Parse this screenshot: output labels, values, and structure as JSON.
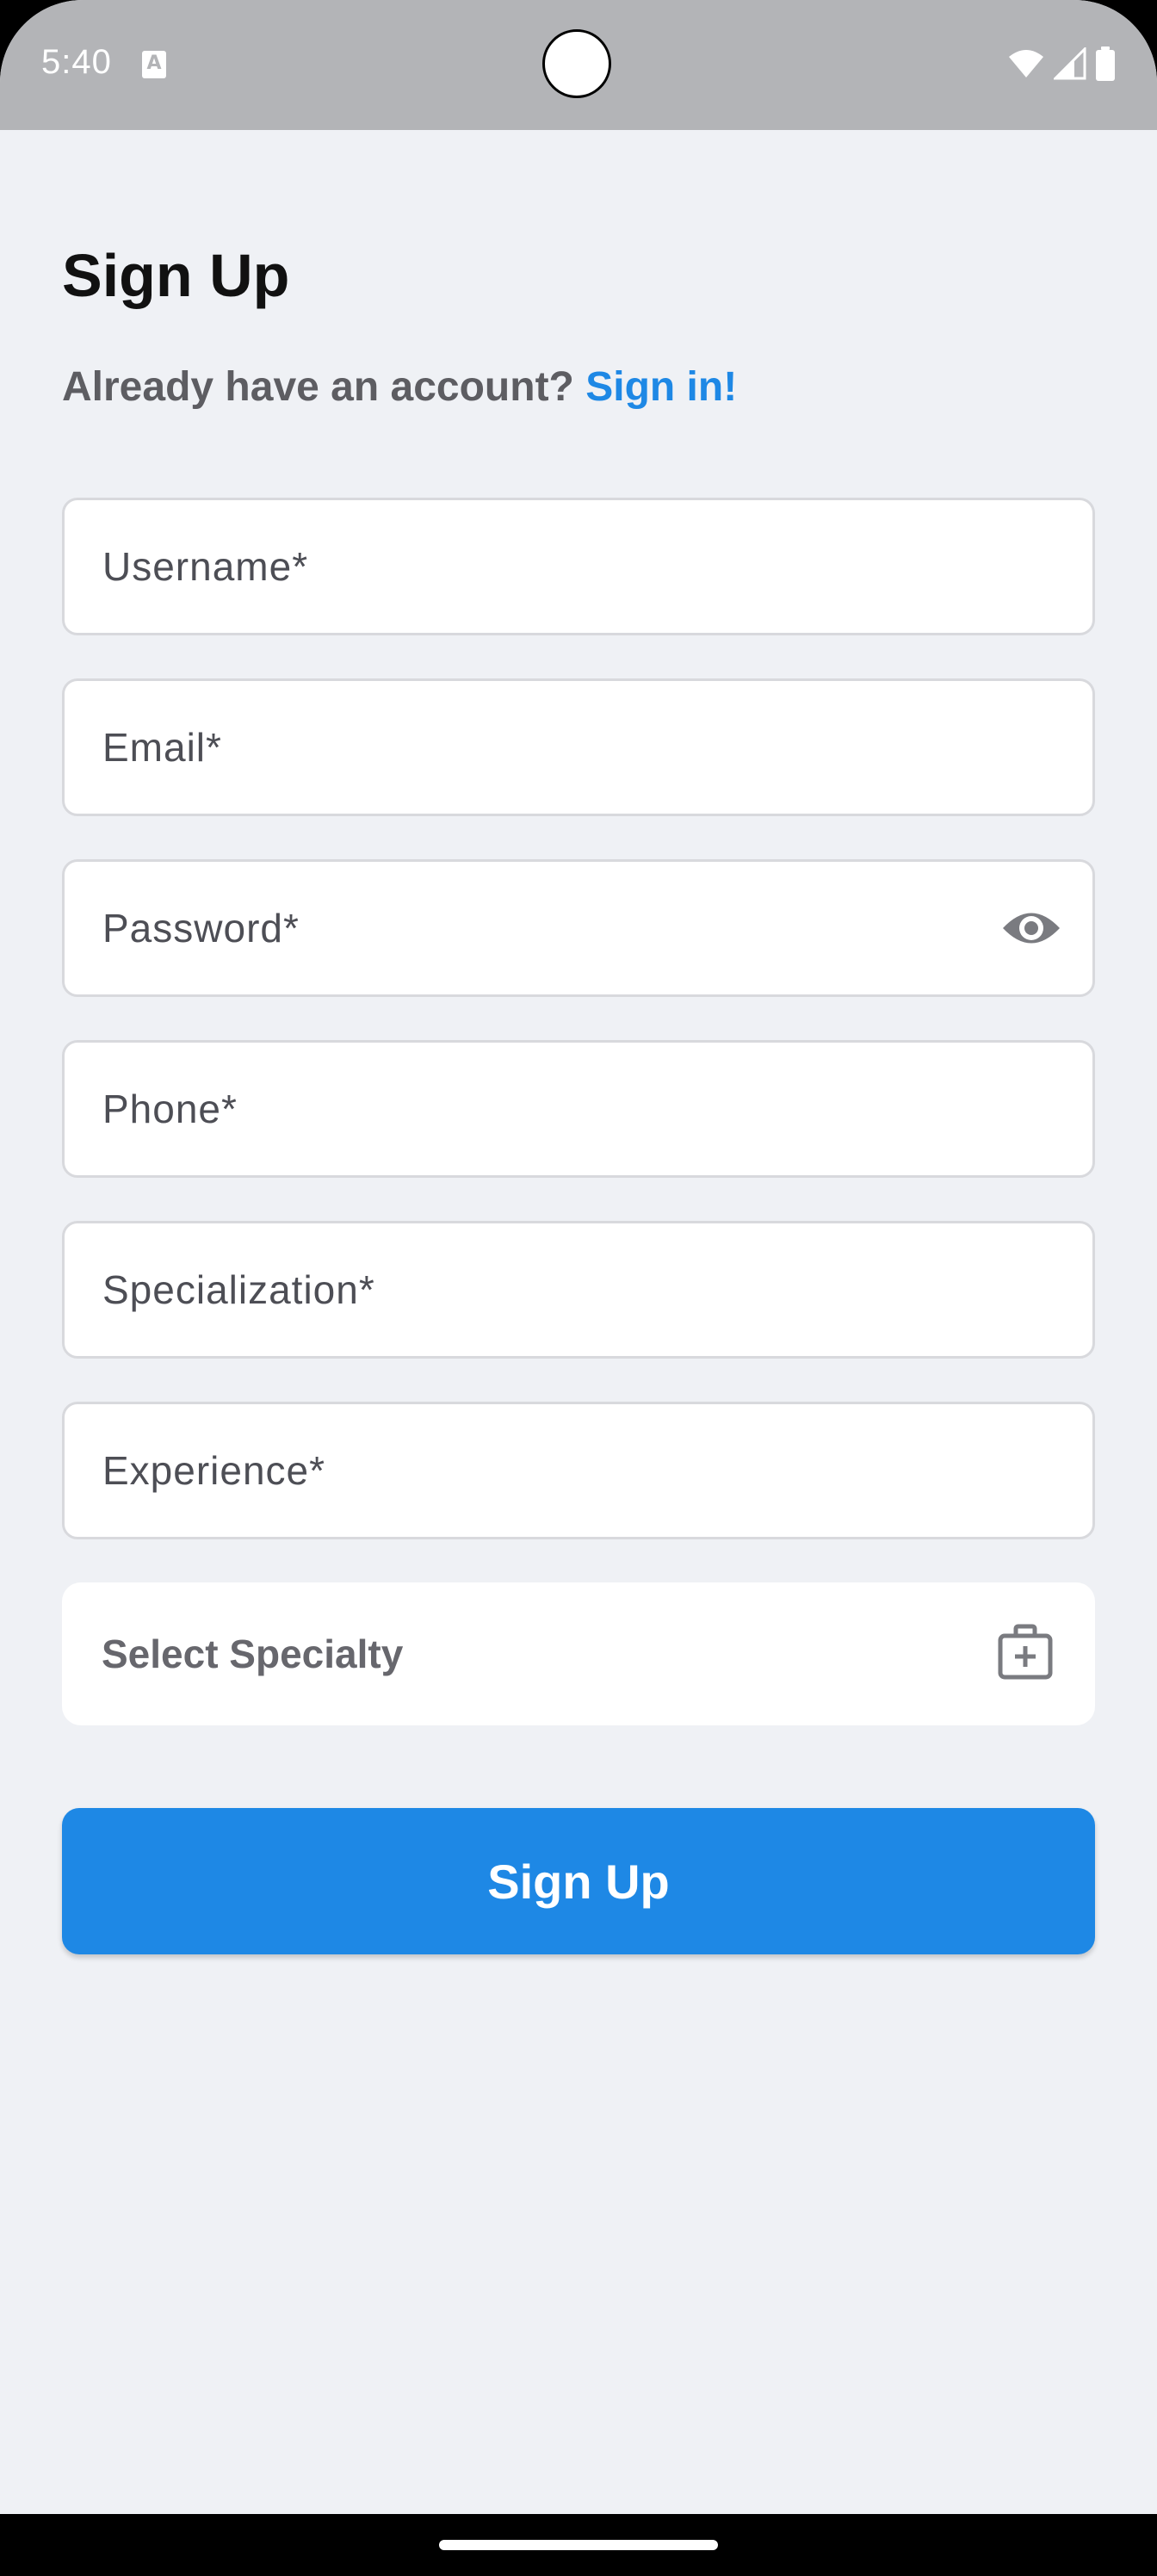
{
  "status_bar": {
    "time": "5:40"
  },
  "header": {
    "title": "Sign Up",
    "already_text": "Already have an account?",
    "signin_link": "Sign in!"
  },
  "form": {
    "username_placeholder": "Username*",
    "email_placeholder": "Email*",
    "password_placeholder": "Password*",
    "phone_placeholder": "Phone*",
    "specialization_placeholder": "Specialization*",
    "experience_placeholder": "Experience*",
    "specialty_label": "Select Specialty",
    "submit_label": "Sign Up"
  },
  "icons": {
    "password_toggle": "eye-icon",
    "specialty": "medical-bag-icon",
    "status": [
      "wifi-icon",
      "cellular-signal-icon",
      "battery-icon"
    ]
  },
  "colors": {
    "accent": "#1e88e5",
    "background": "#eff1f5",
    "status_bar": "#b3b4b7"
  }
}
